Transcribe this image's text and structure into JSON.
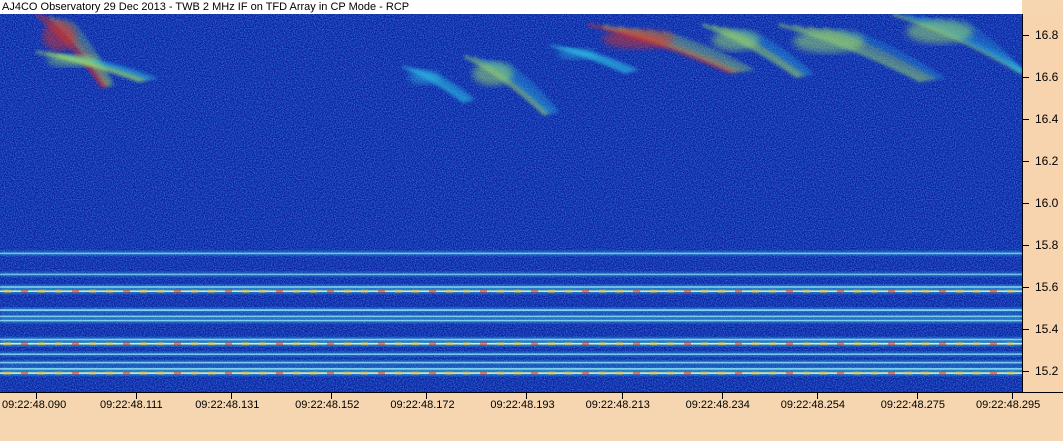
{
  "window": {
    "title": "AJ4CO Observatory 29 Dec 2013 - TWB 2 MHz IF on TFD Array in CP Mode - RCP"
  },
  "chart_data": {
    "type": "heatmap",
    "title": "AJ4CO Observatory 29 Dec 2013 - TWB 2 MHz IF on TFD Array in CP Mode - RCP",
    "xlabel": "",
    "ylabel": "",
    "x_ticks": [
      "09:22:48.090",
      "09:22:48.111",
      "09:22:48.131",
      "09:22:48.152",
      "09:22:48.172",
      "09:22:48.193",
      "09:22:48.213",
      "09:22:48.234",
      "09:22:48.254",
      "09:22:48.275",
      "09:22:48.295"
    ],
    "y_ticks": [
      15.2,
      15.4,
      15.6,
      15.8,
      16.0,
      16.2,
      16.4,
      16.6,
      16.8
    ],
    "ylim": [
      15.1,
      16.9
    ],
    "grid": false,
    "colors": {
      "background": "#0a1f9e",
      "noise": "#1535c8",
      "mid": "#2fb5e0",
      "high": "#9fe36a",
      "peak": "#f0c030",
      "max": "#e03020"
    },
    "horizontal_bands": [
      {
        "freq": 15.19,
        "intensity": 0.95
      },
      {
        "freq": 15.21,
        "intensity": 0.7
      },
      {
        "freq": 15.24,
        "intensity": 0.5
      },
      {
        "freq": 15.28,
        "intensity": 0.45
      },
      {
        "freq": 15.33,
        "intensity": 0.95
      },
      {
        "freq": 15.35,
        "intensity": 0.6
      },
      {
        "freq": 15.44,
        "intensity": 0.55
      },
      {
        "freq": 15.46,
        "intensity": 0.5
      },
      {
        "freq": 15.49,
        "intensity": 0.75
      },
      {
        "freq": 15.58,
        "intensity": 0.85
      },
      {
        "freq": 15.6,
        "intensity": 0.6
      },
      {
        "freq": 15.66,
        "intensity": 0.35
      },
      {
        "freq": 15.76,
        "intensity": 0.4
      }
    ],
    "bursts": [
      {
        "t0": "09:22:48.090",
        "t1": "09:22:48.104",
        "f_high": 16.9,
        "f_low": 16.55,
        "intensity": 0.95
      },
      {
        "t0": "09:22:48.090",
        "t1": "09:22:48.112",
        "f_high": 16.72,
        "f_low": 16.58,
        "intensity": 0.7
      },
      {
        "t0": "09:22:48.167",
        "t1": "09:22:48.180",
        "f_high": 16.65,
        "f_low": 16.48,
        "intensity": 0.45
      },
      {
        "t0": "09:22:48.180",
        "t1": "09:22:48.197",
        "f_high": 16.7,
        "f_low": 16.42,
        "intensity": 0.65
      },
      {
        "t0": "09:22:48.198",
        "t1": "09:22:48.214",
        "f_high": 16.75,
        "f_low": 16.62,
        "intensity": 0.55
      },
      {
        "t0": "09:22:48.206",
        "t1": "09:22:48.236",
        "f_high": 16.85,
        "f_low": 16.62,
        "intensity": 0.9
      },
      {
        "t0": "09:22:48.230",
        "t1": "09:22:48.250",
        "f_high": 16.85,
        "f_low": 16.6,
        "intensity": 0.7
      },
      {
        "t0": "09:22:48.246",
        "t1": "09:22:48.276",
        "f_high": 16.85,
        "f_low": 16.58,
        "intensity": 0.75
      },
      {
        "t0": "09:22:48.270",
        "t1": "09:22:48.298",
        "f_high": 16.9,
        "f_low": 16.62,
        "intensity": 0.6
      }
    ]
  }
}
